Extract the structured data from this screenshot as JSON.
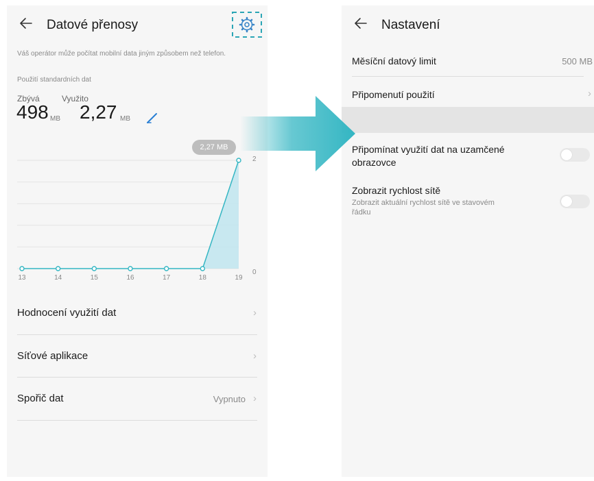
{
  "colors": {
    "accent": "#34b6c3",
    "chart_fill": "#bfe5ee",
    "highlight_box": "#2aa5b5"
  },
  "left": {
    "title": "Datové přenosy",
    "notice": "Váš operátor může počítat mobilní data jiným způsobem než telefon.",
    "std_label": "Použití standardních dat",
    "remaining_label": "Zbývá",
    "remaining_value": "498",
    "remaining_unit": "MB",
    "used_label": "Využito",
    "used_value": "2,27",
    "used_unit": "MB",
    "tooltip": "2,27 MB",
    "rows": [
      {
        "label": "Hodnocení využití dat",
        "value": ""
      },
      {
        "label": "Síťové aplikace",
        "value": ""
      },
      {
        "label": "Spořič dat",
        "value": "Vypnuto"
      }
    ],
    "icons": {
      "back": "arrow-left-icon",
      "settings": "gear-icon",
      "edit": "pencil-icon",
      "chevron": "chevron-right-icon"
    },
    "chevron_glyph": "›"
  },
  "chart_data": {
    "type": "area",
    "x": [
      "13",
      "14",
      "15",
      "16",
      "17",
      "18",
      "19"
    ],
    "values": [
      0,
      0,
      0,
      0,
      0,
      0,
      2.27
    ],
    "yticks": [
      "2",
      "0"
    ],
    "ylim": [
      0,
      2.27
    ],
    "grid": true
  },
  "right": {
    "title": "Nastavení",
    "monthly_limit_label": "Měsíční datový limit",
    "monthly_limit_value": "500 MB",
    "reminder_label": "Připomenutí použití",
    "lockscreen_label_1": "Připomínat využití dat na uzamčené",
    "lockscreen_label_2": "obrazovce",
    "speed_label": "Zobrazit rychlost sítě",
    "speed_sub_1": "Zobrazit aktuální rychlost sítě ve stavovém",
    "speed_sub_2": "řádku",
    "lockscreen_toggle_on": false,
    "speed_toggle_on": false
  }
}
